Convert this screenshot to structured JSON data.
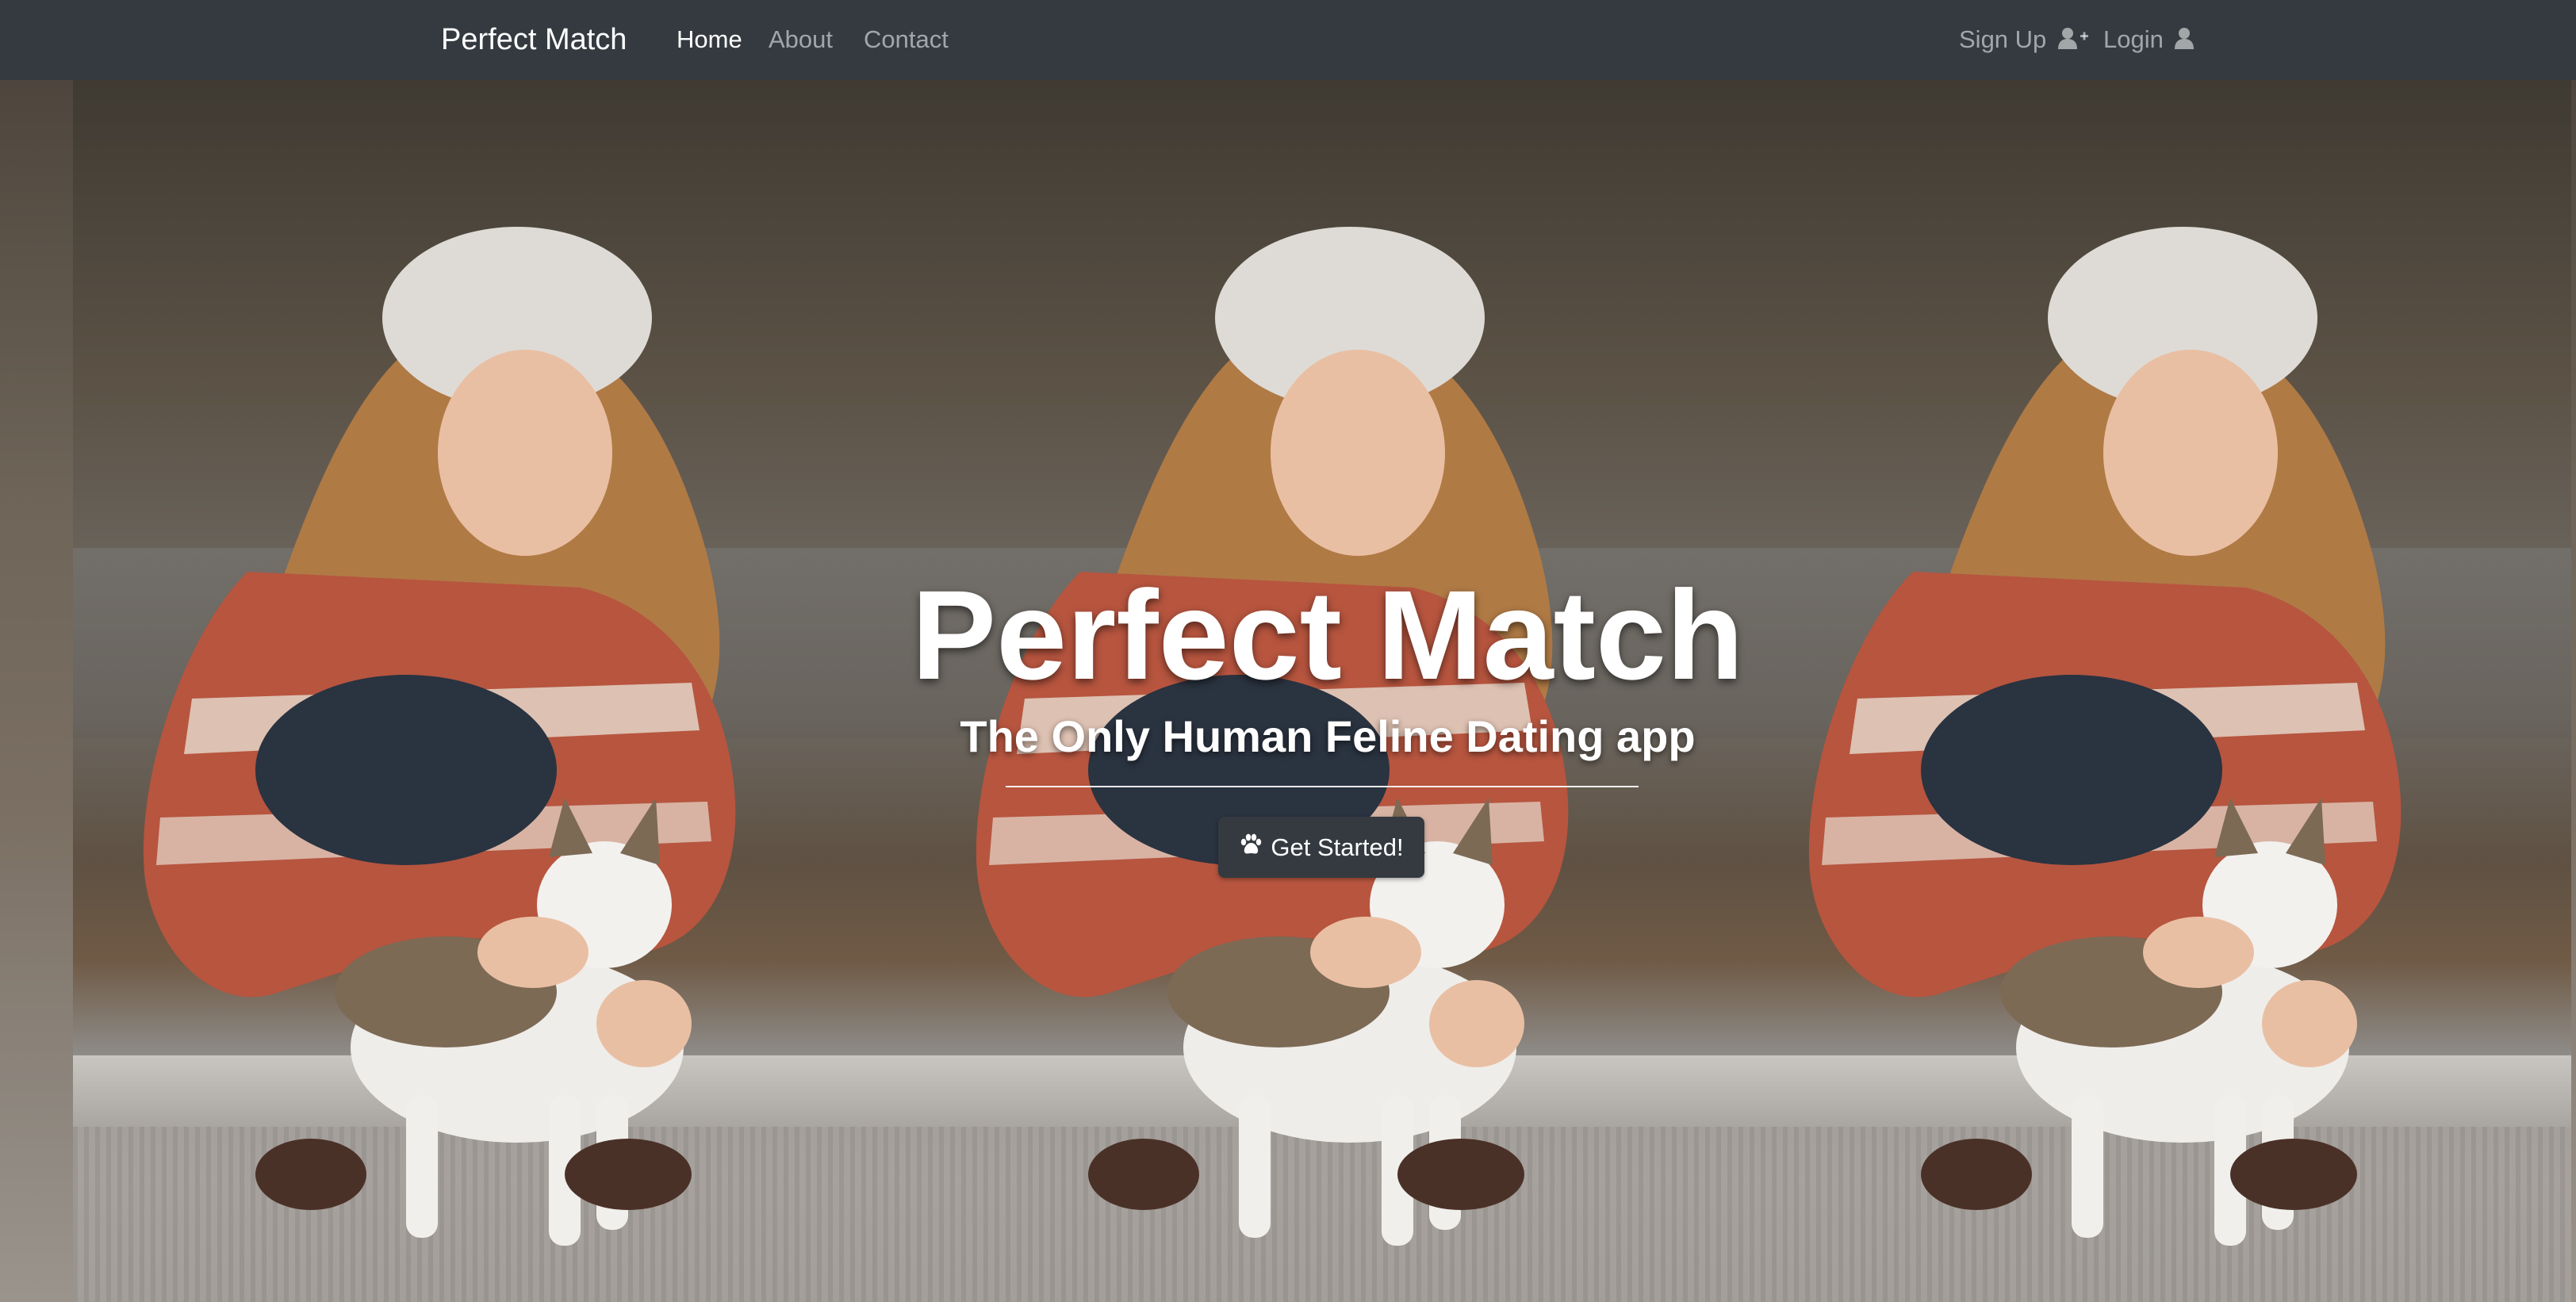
{
  "navbar": {
    "brand": "Perfect Match",
    "links": [
      {
        "label": "Home",
        "active": true
      },
      {
        "label": "About",
        "active": false
      },
      {
        "label": "Contact",
        "active": false
      }
    ],
    "right_links": [
      {
        "label": "Sign Up",
        "icon": "user-plus-icon"
      },
      {
        "label": "Login",
        "icon": "user-icon"
      }
    ]
  },
  "hero": {
    "title": "Perfect Match",
    "subtitle": "The Only Human Feline Dating app",
    "cta": {
      "label": "Get Started!",
      "icon": "paw-icon"
    },
    "background": {
      "description": "repeated photo of woman in knit hat crouching with a cat",
      "tiles": 3
    }
  },
  "colors": {
    "navbar_bg": "#343a40",
    "nav_active": "#ffffff",
    "nav_muted": "rgba(255,255,255,0.55)",
    "button_bg": "#343a40",
    "hero_text": "#ffffff"
  }
}
